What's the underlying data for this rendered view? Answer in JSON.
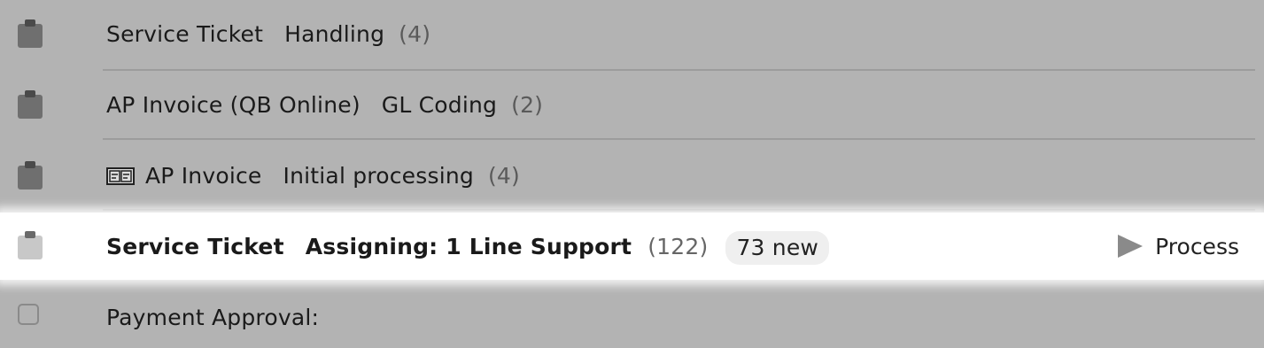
{
  "items": [
    {
      "type": "Service Ticket",
      "step": "Handling",
      "count": "(4)"
    },
    {
      "type": "AP Invoice (QB Online)",
      "step": "GL Coding",
      "count": "(2)"
    },
    {
      "type": "AP Invoice",
      "step": "Initial processing",
      "count": "(4)",
      "type_icon": "document-scan-icon"
    },
    {
      "type": "Service Ticket",
      "step": "Assigning: 1 Line Support",
      "count": "(122)",
      "badge": "73 new",
      "action": "Process",
      "selected": true
    },
    {
      "type": "Payment Approval:",
      "step": "",
      "count": ""
    }
  ],
  "icons": {
    "clipboard": "clipboard-icon",
    "play": "play-icon",
    "checkbox": "checkbox-icon"
  },
  "colors": {
    "background": "#b3b3b3",
    "highlight_row": "#ffffff",
    "clipboard_dim": "#6f6f6f",
    "clipboard_active": "#c8c8c8",
    "badge_bg": "#efefef"
  }
}
